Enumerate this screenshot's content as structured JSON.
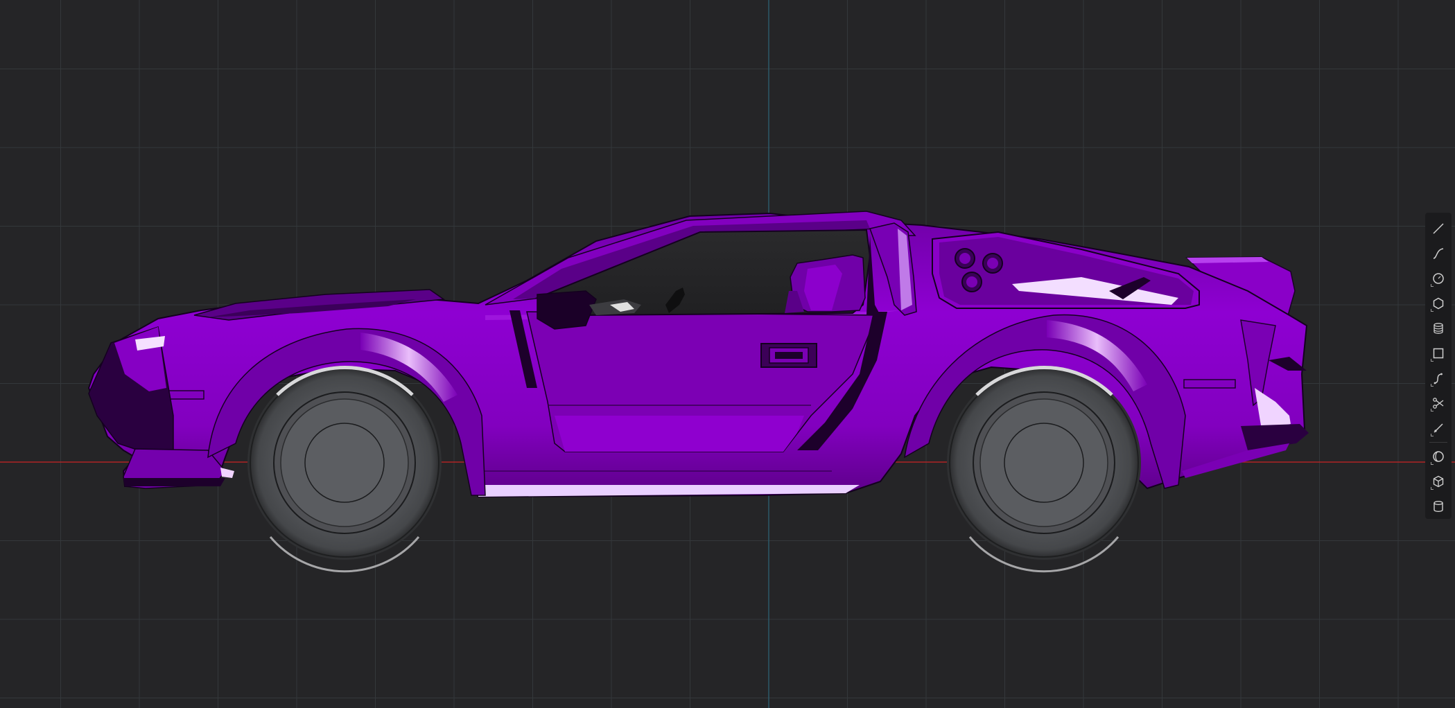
{
  "viewport": {
    "background_color": "#252527",
    "grid_color": "#34383b",
    "x_axis_color": "#b02525",
    "y_axis_color": "#2d5d6e",
    "model_color": "#8a00c8"
  },
  "toolbar": {
    "groups": [
      [
        {
          "name": "line-tool",
          "icon": "line-icon"
        },
        {
          "name": "spline-tool",
          "icon": "spline-icon"
        },
        {
          "name": "circle-tool",
          "icon": "circle-icon"
        },
        {
          "name": "polygon-tool",
          "icon": "polygon-icon"
        },
        {
          "name": "stack-tool",
          "icon": "stack-icon"
        },
        {
          "name": "rectangle-tool",
          "icon": "rectangle-icon"
        },
        {
          "name": "curve-tool",
          "icon": "curve-icon"
        },
        {
          "name": "trim-tool",
          "icon": "scissors-icon"
        },
        {
          "name": "extend-tool",
          "icon": "extend-icon"
        }
      ],
      [
        {
          "name": "shell-tool",
          "icon": "shell-icon"
        },
        {
          "name": "solid-box-tool",
          "icon": "cube-icon"
        },
        {
          "name": "cylinder-tool",
          "icon": "cylinder-icon"
        }
      ]
    ]
  }
}
